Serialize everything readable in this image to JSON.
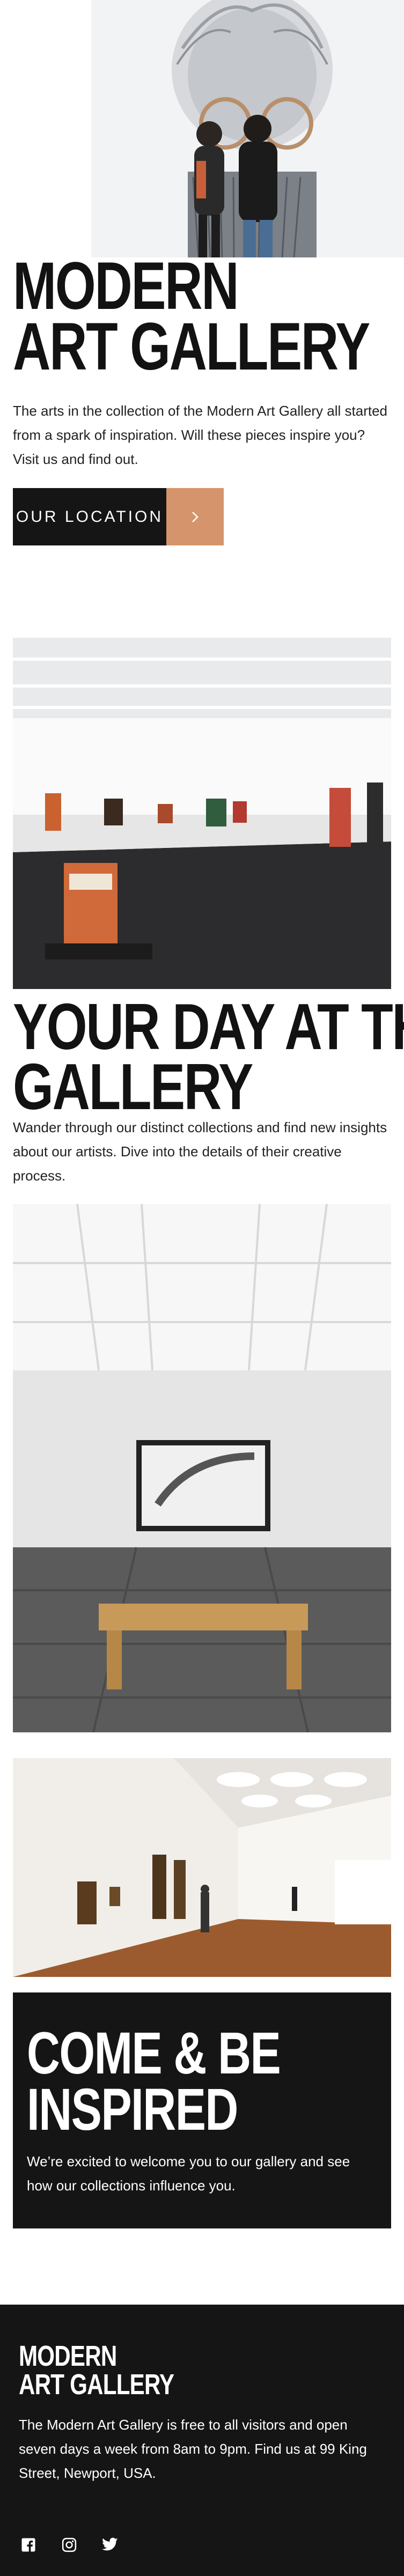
{
  "hero": {
    "title_line1": "Modern",
    "title_line2": "Art Gallery",
    "description": "The arts in the collection of the Modern Art Gallery all started from a spark of inspiration. Will these pieces inspire you? Visit us and find out.",
    "cta_label": "Our Location",
    "cta_icon": "chevron-right-icon"
  },
  "day": {
    "title_line1": "Your day at the",
    "title_line2": "gallery",
    "description": "Wander through our distinct collections and find new insights about our artists. Dive into the details of their creative process."
  },
  "inspired": {
    "title_line1": "Come & be",
    "title_line2": "inspired",
    "description": "We’re excited to welcome you to our gallery and see how our collections influence you."
  },
  "footer": {
    "logo_line1": "Modern",
    "logo_line2": "Art Gallery",
    "description": "The Modern Art Gallery is free to all visitors and open seven days a week from 8am to 9pm. Find us at 99 King Street, Newport, USA.",
    "socials": [
      "facebook-icon",
      "instagram-icon",
      "twitter-icon"
    ]
  },
  "colors": {
    "dark": "#151515",
    "accent": "#d5946c",
    "white": "#ffffff"
  }
}
